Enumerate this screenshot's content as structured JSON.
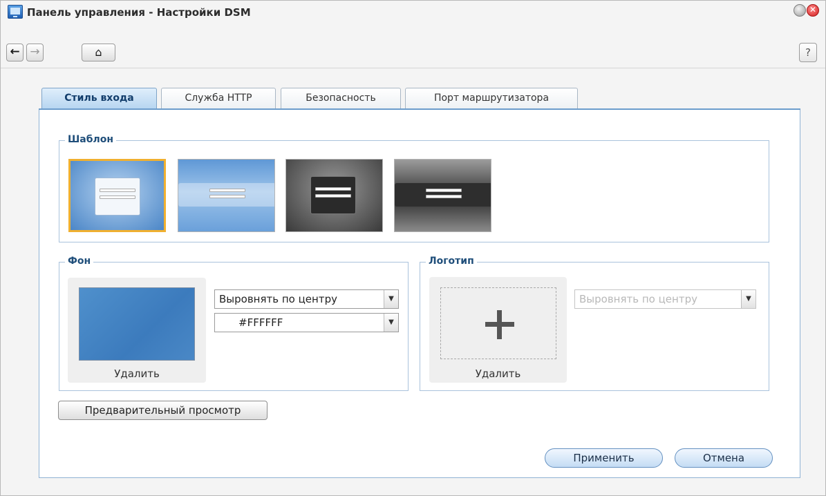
{
  "window": {
    "title": "Панель управления - Настройки DSM",
    "close_glyph": "✕",
    "help_label": "?"
  },
  "toolbar": {
    "back_glyph": "←",
    "forward_glyph": "→",
    "home_glyph": "⌂"
  },
  "tabs": [
    {
      "label": "Стиль входа",
      "active": true
    },
    {
      "label": "Служба HTTP",
      "active": false
    },
    {
      "label": "Безопасность",
      "active": false
    },
    {
      "label": "Порт маршрутизатора",
      "active": false
    }
  ],
  "template_group": {
    "legend": "Шаблон",
    "selected_index": 0
  },
  "background_group": {
    "legend": "Фон",
    "delete_label": "Удалить",
    "align_value": "Выровнять по центру",
    "color_value": "#FFFFFF",
    "preview_color": "#4a8cc9"
  },
  "logo_group": {
    "legend": "Логотип",
    "delete_label": "Удалить",
    "align_value": "Выровнять по центру"
  },
  "actions": {
    "preview_label": "Предварительный просмотр",
    "apply_label": "Применить",
    "cancel_label": "Отмена"
  },
  "colors": {
    "accent": "#1f4e7a",
    "selected_border": "#f0b030",
    "close_button": "#d21d1d"
  }
}
